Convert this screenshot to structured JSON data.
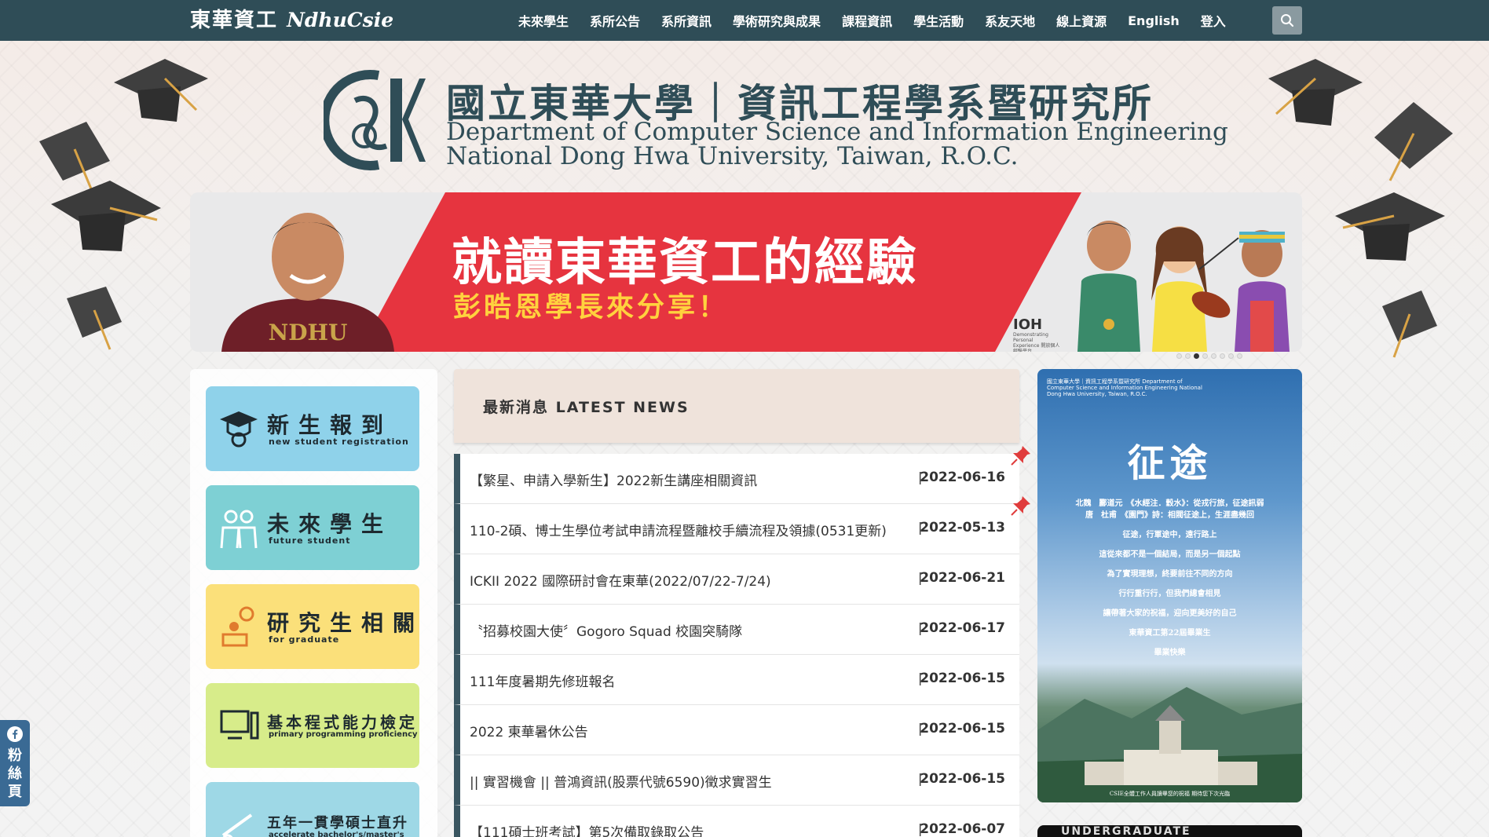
{
  "nav": {
    "brand_zh": "東華資工",
    "brand_latin": "NdhuCsie",
    "items": [
      "未來學生",
      "系所公告",
      "系所資訊",
      "學術研究與成果",
      "課程資訊",
      "學生活動",
      "系友天地",
      "線上資源",
      "English",
      "登入"
    ]
  },
  "header": {
    "title_zh": "國立東華大學｜資訊工程學系暨研究所",
    "title_en_1": "Department of Computer Science and Information Engineering",
    "title_en_2": "National Dong Hwa University, Taiwan, R.O.C."
  },
  "banner": {
    "headline": "就讀東華資工的經驗",
    "subline": "彭晧恩學長來分享！",
    "shirt_text": "NDHU",
    "badge": "IOH",
    "badge_sub": "Demonstrating Personal Experience 開放個人經驗平台",
    "slide_count": 8,
    "active_slide": 3
  },
  "sidebar": {
    "cards": [
      {
        "zh": "新生報到",
        "en": "new student registration",
        "color": "#8fd2ea"
      },
      {
        "zh": "未來學生",
        "en": "future student",
        "color": "#7ed0d4"
      },
      {
        "zh": "研究生相關",
        "en": "for graduate",
        "color": "#fbe07a"
      },
      {
        "zh": "基本程式能力檢定",
        "en": "primary programming proficiency",
        "color": "#d7ec8a"
      },
      {
        "zh": "五年一貫學碩士直升",
        "en": "accelerate bachelor's/master's",
        "color": "#9ed8e6"
      }
    ]
  },
  "news": {
    "header": "最新消息 LATEST NEWS",
    "separator": "|",
    "items": [
      {
        "title": "【繁星、申請入學新生】2022新生講座相關資訊",
        "date": "2022-06-16",
        "pinned": true
      },
      {
        "title": "110-2碩、博士生學位考試申請流程暨離校手續流程及領據(0531更新)",
        "date": "2022-05-13",
        "pinned": true
      },
      {
        "title": "ICKII 2022 國際研討會在東華(2022/07/22-7/24)",
        "date": "2022-06-21",
        "pinned": false
      },
      {
        "title": "〝招募校園大使〞Gogoro Squad 校園突騎隊",
        "date": "2022-06-17",
        "pinned": false
      },
      {
        "title": "111年度暑期先修班報名",
        "date": "2022-06-15",
        "pinned": false
      },
      {
        "title": "2022 東華暑休公告",
        "date": "2022-06-15",
        "pinned": false
      },
      {
        "title": "|| 實習機會 || 普鴻資訊(股票代號6590)徵求實習生",
        "date": "2022-06-15",
        "pinned": false
      },
      {
        "title": "【111碩士班考試】第5次備取錄取公告",
        "date": "2022-06-07",
        "pinned": false
      }
    ]
  },
  "poster": {
    "header": "國立東華大學｜資訊工程學系暨研究所 Department of Computer Science and Information Engineering National Dong Hwa University, Taiwan, R.O.C.",
    "title": "征途",
    "lines": [
      "北魏　酈道元　《水經注．穀水》：從戎行旅，征途訊弱",
      "唐　杜甫　《園門》詩：相閥征途上，生涯盡幾回",
      "征途，行軍途中，遠行路上",
      "這從來都不是一個結局，而是另一個起點",
      "為了實現理想，終要前往不同的方向",
      "行行重行行，但我們總會相見",
      "讓帶著大家的祝福，迎向更美好的自己",
      "東華資工第22屆畢業生",
      "畢業快樂"
    ],
    "footer": "CSIE全體工作人員讀畢您的祝福 期待您下次光臨",
    "next_title": "UNDERGRADUATE"
  },
  "fb": {
    "label": "粉絲頁"
  },
  "colors": {
    "nav_bg": "#2f4d57",
    "banner_red": "#e6343f",
    "banner_yellow": "#ffd23e",
    "news_header_bg": "#efe3db",
    "news_accent": "#3a5661",
    "fb_bg": "#3a6a94"
  }
}
